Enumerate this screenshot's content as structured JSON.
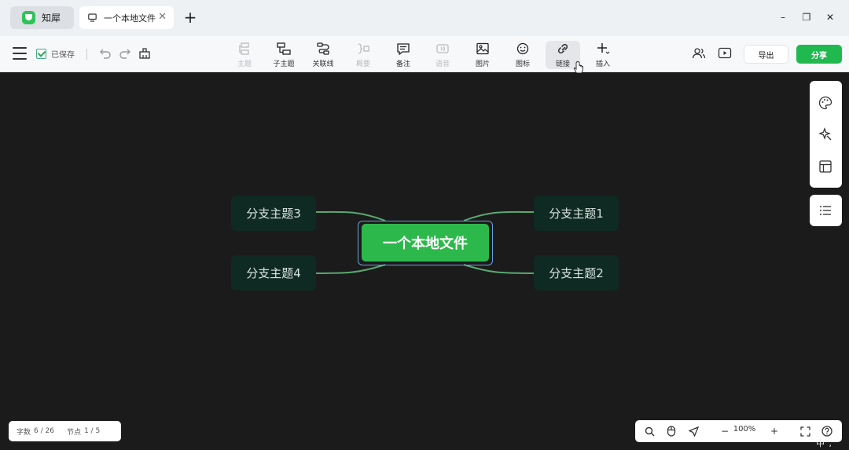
{
  "app": {
    "name": "知犀"
  },
  "tab": {
    "title": "一个本地文件",
    "close": "✕"
  },
  "window": {
    "new_tab": "+",
    "minimize": "–",
    "maximize": "❐",
    "close": "✕"
  },
  "toolbar": {
    "saved_label": "已保存",
    "tools": [
      {
        "label": "主题",
        "icon": "topic-icon",
        "disabled": true
      },
      {
        "label": "子主题",
        "icon": "subtopic-icon",
        "disabled": false
      },
      {
        "label": "关联线",
        "icon": "relation-line-icon",
        "disabled": false
      },
      {
        "label": "概要",
        "icon": "summary-icon",
        "disabled": true
      },
      {
        "label": "备注",
        "icon": "note-icon",
        "disabled": false
      },
      {
        "label": "语音",
        "icon": "voice-icon",
        "disabled": true
      },
      {
        "label": "图片",
        "icon": "image-icon",
        "disabled": false
      },
      {
        "label": "图标",
        "icon": "emoji-icon",
        "disabled": false
      },
      {
        "label": "链接",
        "icon": "link-icon",
        "disabled": false,
        "active": true
      },
      {
        "label": "插入",
        "icon": "insert-icon",
        "disabled": false
      }
    ],
    "export_label": "导出",
    "share_label": "分享"
  },
  "mindmap": {
    "root": "一个本地文件",
    "branches": [
      "分支主题1",
      "分支主题2",
      "分支主题3",
      "分支主题4"
    ]
  },
  "stats": {
    "words_label": "字数",
    "words_value": "6 / 26",
    "nodes_label": "节点",
    "nodes_value": "1 / 5"
  },
  "zoom": {
    "value": "100%",
    "minus": "−",
    "plus": "+"
  },
  "ime": {
    "text": "中°,"
  },
  "colors": {
    "accent": "#20b94f",
    "root": "#2db84b",
    "branch_bg": "#0e2a22",
    "canvas": "#1b1b1b",
    "link": "#5aa870",
    "selection": "#6aa0d8"
  }
}
